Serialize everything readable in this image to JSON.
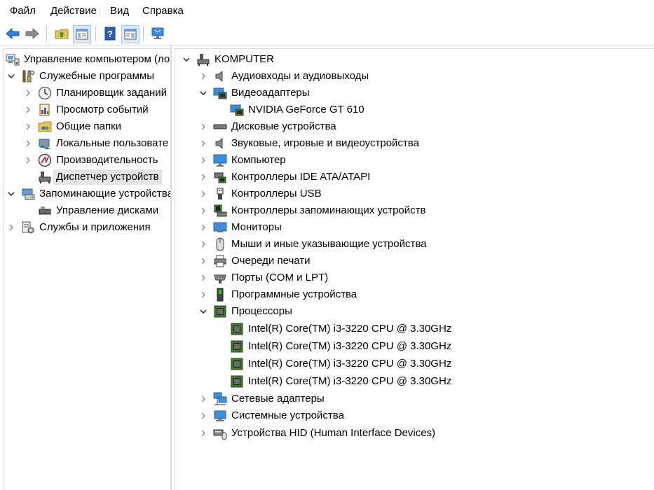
{
  "menu": {
    "file": "Файл",
    "action": "Действие",
    "view": "Вид",
    "help": "Справка"
  },
  "toolbar": {
    "buttons": [
      "back-icon",
      "forward-icon",
      "up-folder-icon",
      "show-hide-tree-icon",
      "help-icon",
      "properties-icon",
      "monitor-icon"
    ]
  },
  "left_tree": {
    "root": "Управление компьютером (ло",
    "system_tools": "Служебные программы",
    "task_scheduler": "Планировщик заданий",
    "event_viewer": "Просмотр событий",
    "shared_folders": "Общие папки",
    "local_users": "Локальные пользовате",
    "performance": "Производительность",
    "device_manager": "Диспетчер устройств",
    "storage": "Запоминающие устройства",
    "disk_management": "Управление дисками",
    "services_apps": "Службы и приложения"
  },
  "device_tree": {
    "computer_name": "KOMPUTER",
    "audio_io": "Аудиовходы и аудиовыходы",
    "display_adapters": "Видеоадаптеры",
    "gpu": "NVIDIA GeForce GT 610",
    "disk_drives": "Дисковые устройства",
    "sound_video": "Звуковые, игровые и видеоустройства",
    "computer": "Компьютер",
    "ide_controllers": "Контроллеры IDE ATA/ATAPI",
    "usb_controllers": "Контроллеры USB",
    "storage_controllers": "Контроллеры запоминающих устройств",
    "monitors": "Мониторы",
    "mice": "Мыши и иные указывающие устройства",
    "print_queues": "Очереди печати",
    "ports": "Порты (COM и LPT)",
    "software_devices": "Программные устройства",
    "processors": "Процессоры",
    "cpu_1": "Intel(R) Core(TM) i3-3220 CPU @ 3.30GHz",
    "cpu_2": "Intel(R) Core(TM) i3-3220 CPU @ 3.30GHz",
    "cpu_3": "Intel(R) Core(TM) i3-3220 CPU @ 3.30GHz",
    "cpu_4": "Intel(R) Core(TM) i3-3220 CPU @ 3.30GHz",
    "network_adapters": "Сетевые адаптеры",
    "system_devices": "Системные устройства",
    "hid": "Устройства HID (Human Interface Devices)"
  },
  "colors": {
    "selection_gray": "#e5e5e5",
    "selection_blue": "#dbe9f8",
    "arrow_blue": "#2f7fd3",
    "chip_green": "#3f7a2b"
  }
}
